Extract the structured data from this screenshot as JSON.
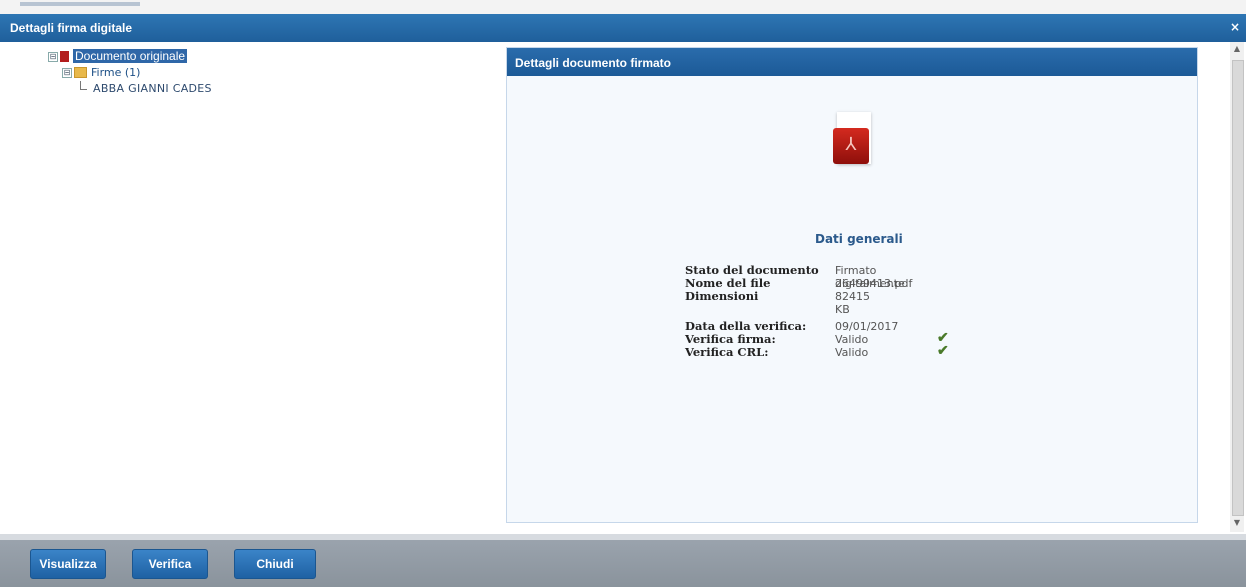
{
  "window": {
    "title": "Dettagli firma digitale",
    "close_glyph": "×"
  },
  "tree": {
    "root": {
      "label": "Documento originale",
      "toggle": "⊟",
      "icon": "pdf-document-icon"
    },
    "folder": {
      "label": "Firme (1)",
      "toggle": "⊟",
      "icon": "folder-icon"
    },
    "leaf": {
      "label": "ABBA  GIANNI CADES"
    }
  },
  "panel": {
    "title": "Dettagli documento firmato",
    "icon": "pdf-file-icon",
    "section_title": "Dati generali",
    "general": [
      {
        "label": "Stato del documento",
        "value": "Firmato digitalmente"
      },
      {
        "label": "Nome del file",
        "value": "26499413.pdf"
      },
      {
        "label": "Dimensioni",
        "value": "82415 KB"
      }
    ],
    "verification": [
      {
        "label": "Data della verifica:",
        "value": "09/01/2017"
      },
      {
        "label": "Verifica firma:",
        "value": "Valido",
        "check": "✔"
      },
      {
        "label": "Verifica CRL:",
        "value": "Valido",
        "check": "✔"
      }
    ]
  },
  "buttons": {
    "view": "Visualizza",
    "verify": "Verifica",
    "close": "Chiudi"
  },
  "colors": {
    "title_bar": "#1f5f9b",
    "panel_header": "#1c5a97",
    "button": "#2a72b8",
    "check": "#4a7a2a"
  }
}
